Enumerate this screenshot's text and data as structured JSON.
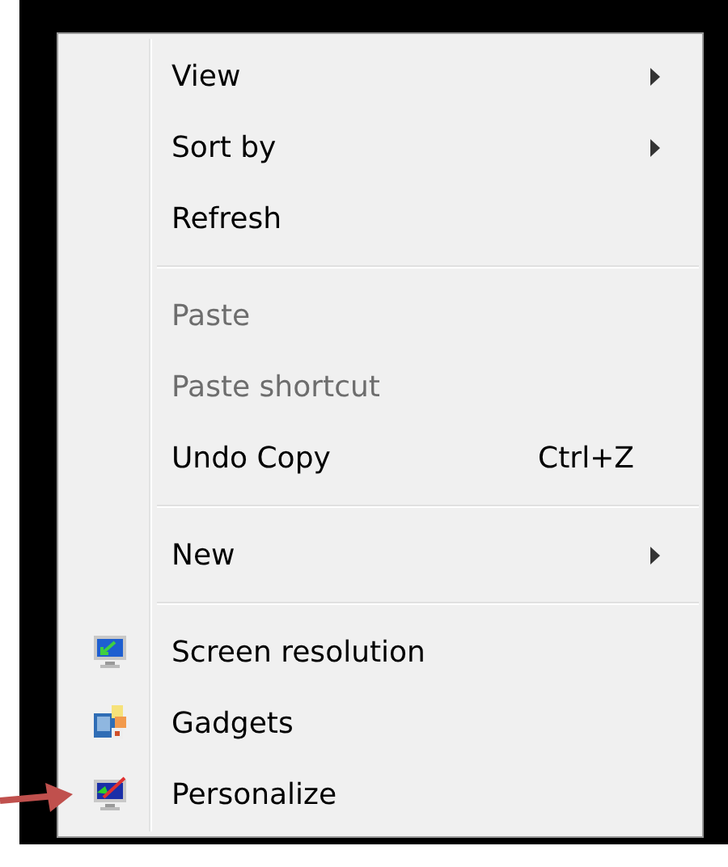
{
  "menu": {
    "items": [
      {
        "kind": "item",
        "label": "View",
        "disabled": false,
        "submenu": true
      },
      {
        "kind": "item",
        "label": "Sort by",
        "disabled": false,
        "submenu": true
      },
      {
        "kind": "item",
        "label": "Refresh",
        "disabled": false,
        "submenu": false
      },
      {
        "kind": "separator"
      },
      {
        "kind": "item",
        "label": "Paste",
        "disabled": true,
        "submenu": false
      },
      {
        "kind": "item",
        "label": "Paste shortcut",
        "disabled": true,
        "submenu": false
      },
      {
        "kind": "item",
        "label": "Undo Copy",
        "disabled": false,
        "submenu": false,
        "shortcut": "Ctrl+Z"
      },
      {
        "kind": "separator"
      },
      {
        "kind": "item",
        "label": "New",
        "disabled": false,
        "submenu": true
      },
      {
        "kind": "separator"
      },
      {
        "kind": "item",
        "label": "Screen resolution",
        "disabled": false,
        "submenu": false
      },
      {
        "kind": "item",
        "label": "Gadgets",
        "disabled": false,
        "submenu": false
      },
      {
        "kind": "item",
        "label": "Personalize",
        "disabled": false,
        "submenu": false
      }
    ]
  }
}
